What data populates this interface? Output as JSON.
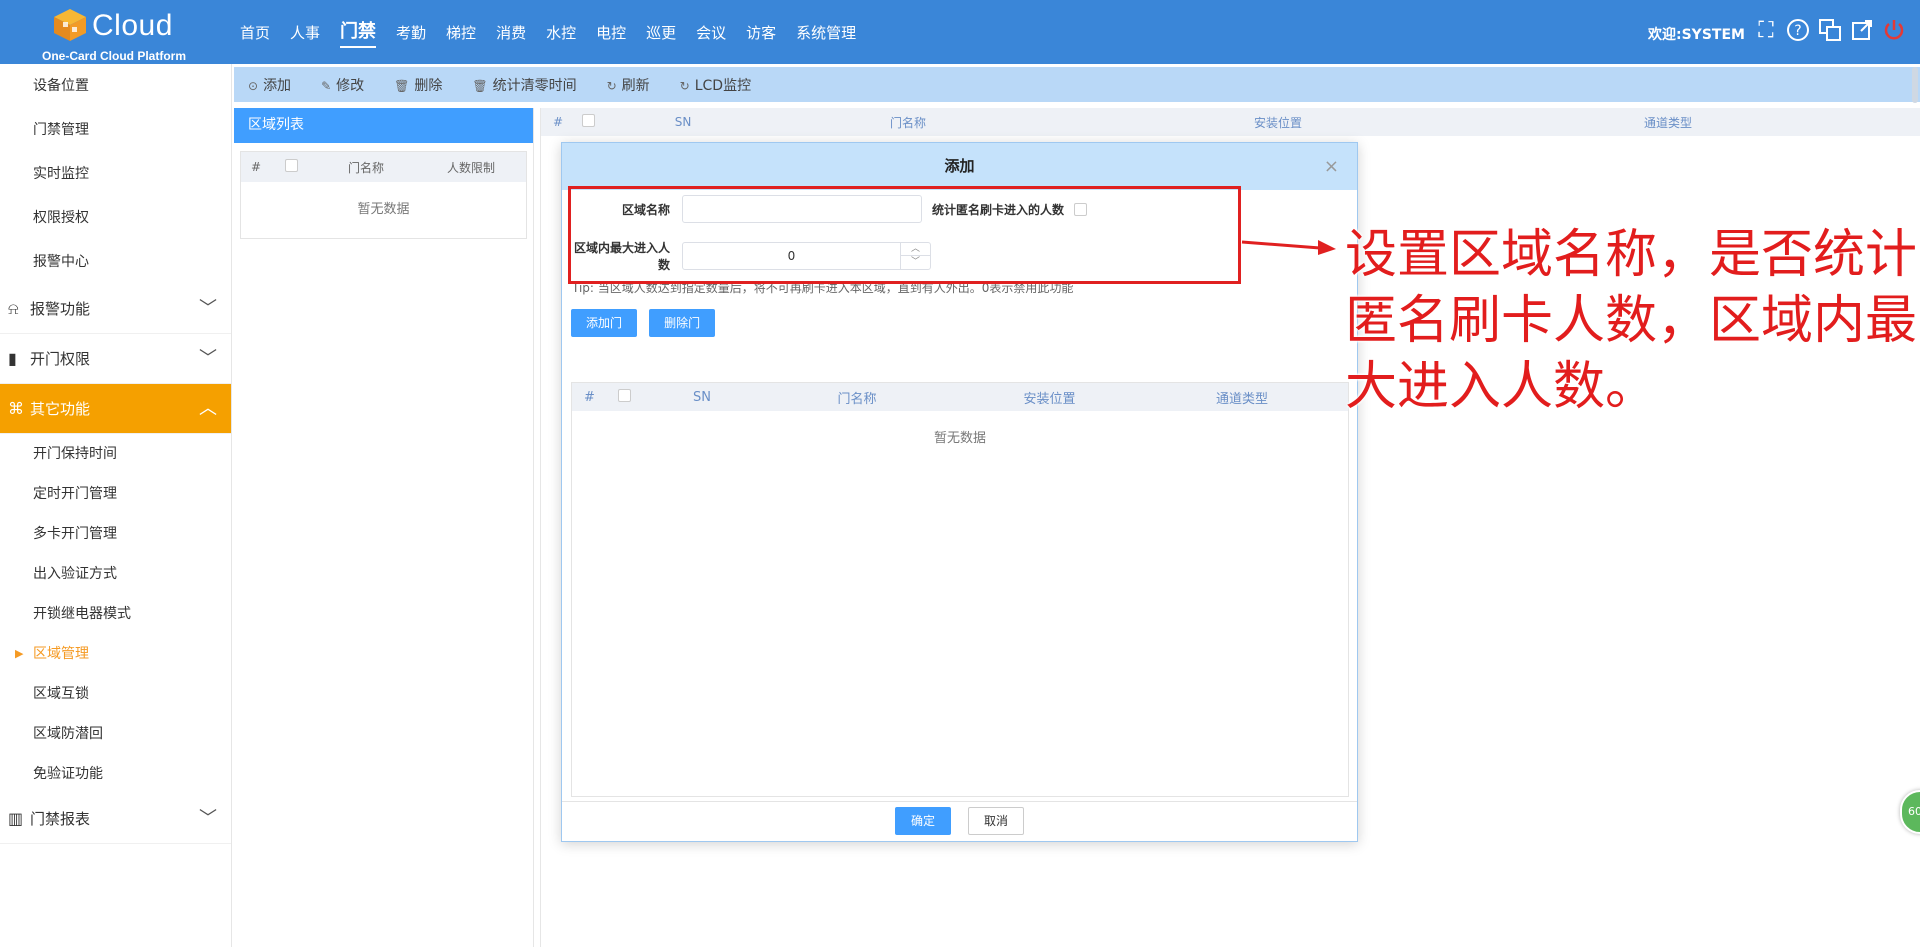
{
  "brand": {
    "logo_text": "Cloud",
    "logo_sub": "One-Card Cloud Platform"
  },
  "topnav": {
    "items": [
      "首页",
      "人事",
      "门禁",
      "考勤",
      "梯控",
      "消费",
      "水控",
      "电控",
      "巡更",
      "会议",
      "访客",
      "系统管理"
    ],
    "active": "门禁"
  },
  "header": {
    "welcome": "欢迎:SYSTEM",
    "icons": [
      "fullscreen-icon",
      "help-icon",
      "language-icon",
      "external-link-icon",
      "power-icon"
    ]
  },
  "sidebar": {
    "top_items": [
      "设备位置",
      "门禁管理",
      "实时监控",
      "权限授权",
      "报警中心"
    ],
    "groups": {
      "alarm": "报警功能",
      "door_permission": "开门权限",
      "other": "其它功能",
      "report": "门禁报表"
    },
    "other_items": [
      "开门保持时间",
      "定时开门管理",
      "多卡开门管理",
      "出入验证方式",
      "开锁继电器模式",
      "区域管理",
      "区域互锁",
      "区域防潜回",
      "免验证功能"
    ],
    "active_item": "区域管理"
  },
  "toolbar": {
    "add": "添加",
    "edit": "修改",
    "delete": "删除",
    "reset_stats": "统计清零时间",
    "refresh": "刷新",
    "lcd": "LCD监控"
  },
  "region_panel": {
    "title": "区域列表",
    "columns": [
      "#",
      "门名称",
      "人数限制"
    ],
    "empty": "暂无数据"
  },
  "main_grid": {
    "columns": [
      "#",
      "SN",
      "门名称",
      "安装位置",
      "通道类型"
    ]
  },
  "modal": {
    "title": "添加",
    "close": "×",
    "area_name_label": "区域名称",
    "area_name_value": "",
    "anonymous_label": "统计匿名刷卡进入的人数",
    "anonymous_checked": false,
    "max_people_label": "区域内最大进入人数",
    "max_people_value": "0",
    "tip": "Tip: 当区域人数达到指定数量后，将不可再刷卡进入本区域，直到有人外出。0表示禁用此功能",
    "add_door": "添加门",
    "delete_door": "删除门",
    "door_columns": [
      "#",
      "SN",
      "门名称",
      "安装位置",
      "通道类型"
    ],
    "door_empty": "暂无数据",
    "confirm": "确定",
    "cancel": "取消"
  },
  "annotation": {
    "text": "设置区域名称，是否统计匿名刷卡人数，区域内最大进入人数。",
    "color": "#e21d1d"
  },
  "badge": {
    "text": "60"
  },
  "colors": {
    "topbar": "#3a86d8",
    "active_group": "#f5a000",
    "primary": "#409eff",
    "toolbar": "#b9d8f7"
  }
}
